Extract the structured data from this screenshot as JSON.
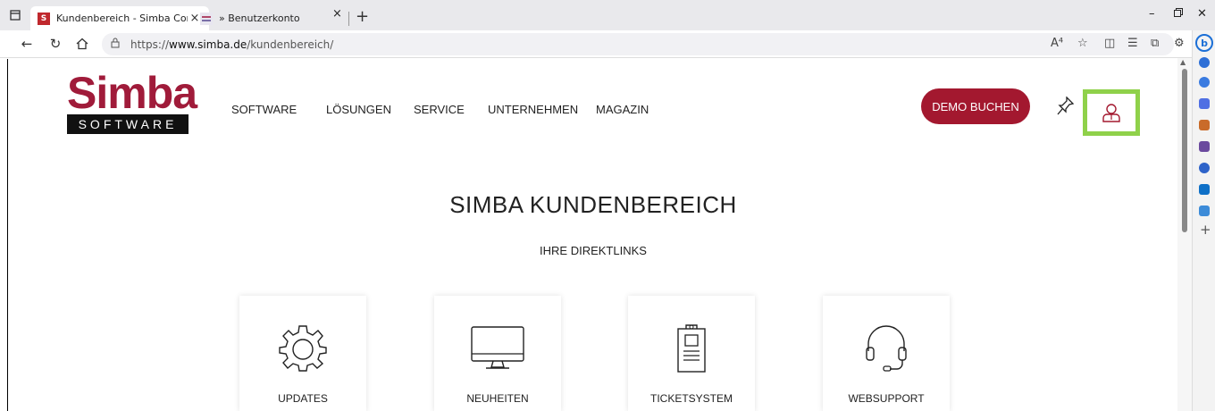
{
  "browser": {
    "tabs": [
      {
        "title": "Kundenbereich - Simba Compute",
        "favicon": "S"
      },
      {
        "title": "» Benutzerkonto",
        "favicon": ""
      }
    ],
    "tab_close": "×",
    "new_tab": "+",
    "url_prefix": "https://",
    "url_host": "www.simba.de",
    "url_path": "/kundenbereich/",
    "read_aloud": "A⁴",
    "more": "···"
  },
  "site": {
    "logo_top": "Simba",
    "logo_bottom": "SOFTWARE",
    "menu": [
      "SOFTWARE",
      "LÖSUNGEN",
      "SERVICE",
      "UNTERNEHMEN",
      "MAGAZIN"
    ],
    "demo_button": "DEMO BUCHEN",
    "headline": "SIMBA KUNDENBEREICH",
    "subheadline": "IHRE DIREKTLINKS",
    "cards": [
      {
        "label": "UPDATES",
        "icon": "gear-icon"
      },
      {
        "label": "NEUHEITEN",
        "icon": "monitor-icon"
      },
      {
        "label": "TICKETSYSTEM",
        "icon": "clipboard-icon"
      },
      {
        "label": "WEBSUPPORT",
        "icon": "headset-icon"
      }
    ]
  },
  "colors": {
    "brand": "#a3182f",
    "highlight": "#8fd14a"
  }
}
